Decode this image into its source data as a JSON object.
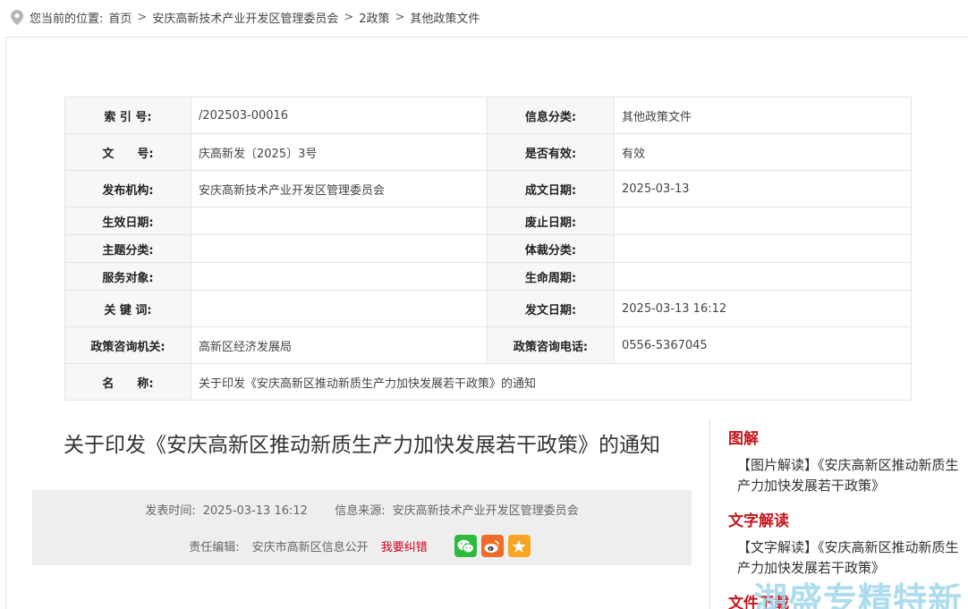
{
  "breadcrumb": {
    "prefix": "您当前的位置:",
    "items": [
      "首页",
      "安庆高新技术产业开发区管理委员会",
      "2政策",
      "其他政策文件"
    ]
  },
  "info": {
    "rows": [
      {
        "k1": "索 引 号:",
        "v1": "/202503-00016",
        "k2": "信息分类:",
        "v2": "其他政策文件"
      },
      {
        "k1": "文　　号:",
        "v1": "庆高新发〔2025〕3号",
        "k2": "是否有效:",
        "v2": "有效"
      },
      {
        "k1": "发布机构:",
        "v1": "安庆高新技术产业开发区管理委员会",
        "k2": "成文日期:",
        "v2": "2025-03-13"
      },
      {
        "k1": "生效日期:",
        "v1": "",
        "k2": "废止日期:",
        "v2": ""
      },
      {
        "k1": "主题分类:",
        "v1": "",
        "k2": "体裁分类:",
        "v2": ""
      },
      {
        "k1": "服务对象:",
        "v1": "",
        "k2": "生命周期:",
        "v2": ""
      },
      {
        "k1": "关 键 词:",
        "v1": "",
        "k2": "发文日期:",
        "v2": "2025-03-13 16:12"
      },
      {
        "k1": "政策咨询机关:",
        "v1": "高新区经济发展局",
        "k2": "政策咨询电话:",
        "v2": "0556-5367045"
      }
    ],
    "name_key": "名　　称:",
    "name_value": "关于印发《安庆高新区推动新质生产力加快发展若干政策》的通知"
  },
  "article": {
    "title": "关于印发《安庆高新区推动新质生产力加快发展若干政策》的通知",
    "publish_label": "发表时间:",
    "publish_time": "2025-03-13 16:12",
    "source_label": "信息来源:",
    "source": "安庆高新技术产业开发区管理委员会",
    "editor_label": "责任编辑:",
    "editor": "安庆市高新区信息公开",
    "correct_label": "我要纠错",
    "share_icons": [
      "wechat-icon",
      "weibo-icon",
      "favorite-icon"
    ],
    "colors": {
      "wechat": "#2dbb3d",
      "weibo": "#ef6b2b",
      "favorite": "#f6a623"
    }
  },
  "sidebar": {
    "heading1": "图解",
    "link1": "【图片解读】《安庆高新区推动新质生产力加快发展若干政策》",
    "heading2": "文字解读",
    "link2": "【文字解读】《安庆高新区推动新质生产力加快发展若干政策》",
    "heading3": "文件下载",
    "accent": "#c4161c"
  },
  "watermark": "湖盛专精特新"
}
